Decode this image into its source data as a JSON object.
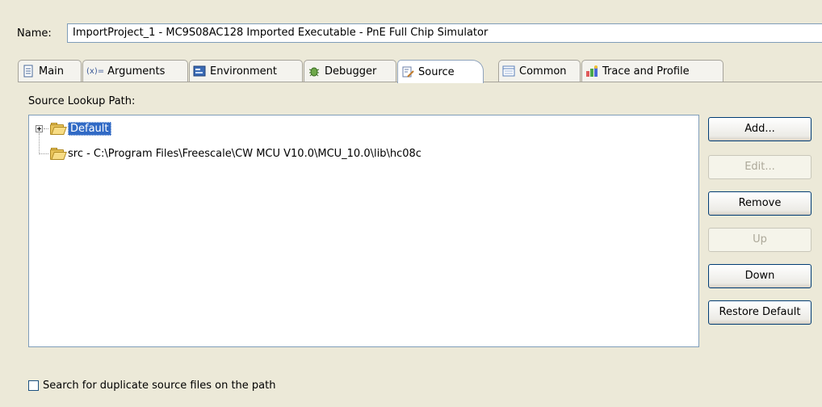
{
  "name_field": {
    "label": "Name:",
    "value": "ImportProject_1 - MC9S08AC128 Imported Executable - PnE Full Chip Simulator"
  },
  "tabs": [
    {
      "label": "Main",
      "icon": "page-icon",
      "active": false
    },
    {
      "label": "Arguments",
      "icon": "arguments-icon",
      "prefix": "(x)=",
      "active": false
    },
    {
      "label": "Environment",
      "icon": "environment-icon",
      "active": false
    },
    {
      "label": "Debugger",
      "icon": "debugger-bug-icon",
      "active": false
    },
    {
      "label": "Source",
      "icon": "source-icon",
      "active": true
    },
    {
      "label": "Common",
      "icon": "common-icon",
      "active": false
    },
    {
      "label": "Trace and Profile",
      "icon": "trace-profile-icon",
      "active": false
    }
  ],
  "source_lookup": {
    "label": "Source Lookup Path:",
    "items": [
      {
        "label": "Default",
        "icon": "folder-icon",
        "selected": true,
        "expandable": true
      },
      {
        "label": "src - C:\\Program Files\\Freescale\\CW MCU V10.0\\MCU_10.0\\lib\\hc08c",
        "icon": "folder-icon",
        "selected": false,
        "expandable": false
      }
    ]
  },
  "buttons": {
    "add": "Add...",
    "edit": "Edit...",
    "remove": "Remove",
    "up": "Up",
    "down": "Down",
    "restore": "Restore Default"
  },
  "duplicate_checkbox": {
    "label": "Search for duplicate source files on the path",
    "checked": false
  },
  "colors": {
    "selection": "#316ac5",
    "panel_bg": "#ece9d8",
    "border": "#7f9db9"
  }
}
